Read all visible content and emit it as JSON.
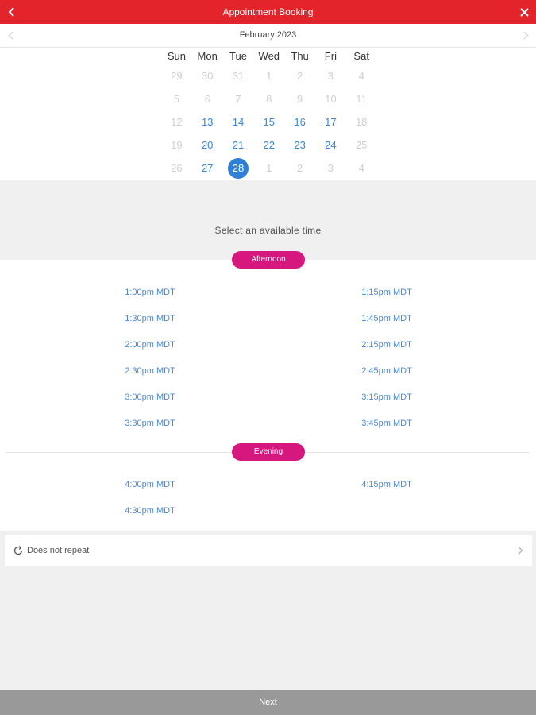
{
  "header": {
    "title": "Appointment Booking"
  },
  "calendar": {
    "month": "February 2023",
    "weekdays": [
      "Sun",
      "Mon",
      "Tue",
      "Wed",
      "Thu",
      "Fri",
      "Sat"
    ],
    "weeks": [
      [
        {
          "d": "29",
          "s": "muted"
        },
        {
          "d": "30",
          "s": "muted"
        },
        {
          "d": "31",
          "s": "muted"
        },
        {
          "d": "1",
          "s": "muted"
        },
        {
          "d": "2",
          "s": "muted"
        },
        {
          "d": "3",
          "s": "muted"
        },
        {
          "d": "4",
          "s": "muted"
        }
      ],
      [
        {
          "d": "5",
          "s": "muted"
        },
        {
          "d": "6",
          "s": "muted"
        },
        {
          "d": "7",
          "s": "muted"
        },
        {
          "d": "8",
          "s": "muted"
        },
        {
          "d": "9",
          "s": "muted"
        },
        {
          "d": "10",
          "s": "muted"
        },
        {
          "d": "11",
          "s": "muted"
        }
      ],
      [
        {
          "d": "12",
          "s": "muted"
        },
        {
          "d": "13",
          "s": "avail"
        },
        {
          "d": "14",
          "s": "avail"
        },
        {
          "d": "15",
          "s": "avail"
        },
        {
          "d": "16",
          "s": "avail"
        },
        {
          "d": "17",
          "s": "avail"
        },
        {
          "d": "18",
          "s": "muted"
        }
      ],
      [
        {
          "d": "19",
          "s": "muted"
        },
        {
          "d": "20",
          "s": "avail"
        },
        {
          "d": "21",
          "s": "avail"
        },
        {
          "d": "22",
          "s": "avail"
        },
        {
          "d": "23",
          "s": "avail"
        },
        {
          "d": "24",
          "s": "avail"
        },
        {
          "d": "25",
          "s": "muted"
        }
      ],
      [
        {
          "d": "26",
          "s": "muted"
        },
        {
          "d": "27",
          "s": "avail"
        },
        {
          "d": "28",
          "s": "selected"
        },
        {
          "d": "1",
          "s": "muted"
        },
        {
          "d": "2",
          "s": "muted"
        },
        {
          "d": "3",
          "s": "muted"
        },
        {
          "d": "4",
          "s": "muted"
        }
      ]
    ]
  },
  "time_select": {
    "label": "Select an available time",
    "sections": [
      {
        "name": "Afternoon",
        "left": [
          "1:00pm MDT",
          "1:30pm MDT",
          "2:00pm MDT",
          "2:30pm MDT",
          "3:00pm MDT",
          "3:30pm MDT"
        ],
        "right": [
          "1:15pm MDT",
          "1:45pm MDT",
          "2:15pm MDT",
          "2:45pm MDT",
          "3:15pm MDT",
          "3:45pm MDT"
        ]
      },
      {
        "name": "Evening",
        "left": [
          "4:00pm MDT",
          "4:30pm MDT"
        ],
        "right": [
          "4:15pm MDT"
        ]
      }
    ]
  },
  "repeat": {
    "label": "Does not repeat"
  },
  "footer": {
    "next_label": "Next"
  },
  "colors": {
    "header_bg": "#e3242b",
    "accent_blue": "#2f7fd6",
    "section_pill": "#d6177d",
    "footer_bg": "#999999"
  },
  "icons": {
    "back": "chevron-left-icon",
    "close": "close-icon",
    "prev_month": "chevron-left-icon",
    "next_month": "chevron-right-icon",
    "repeat": "refresh-icon",
    "repeat_chevron": "chevron-right-icon"
  }
}
